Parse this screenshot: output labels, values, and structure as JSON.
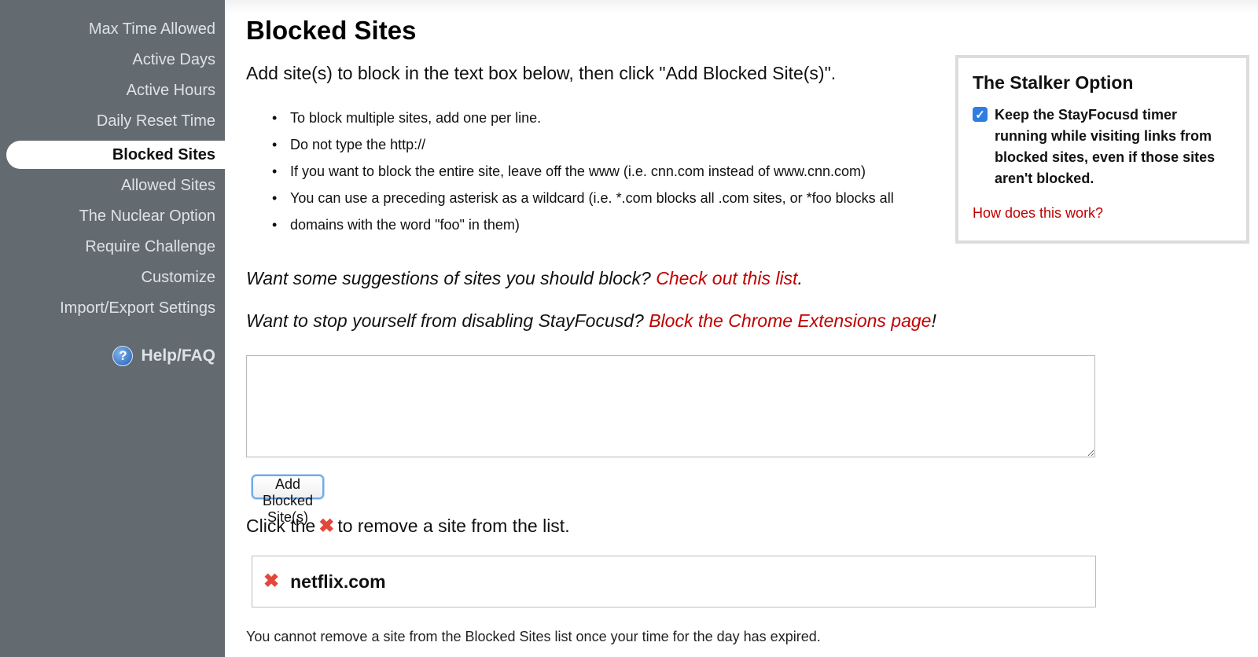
{
  "sidebar": {
    "items": [
      {
        "label": "Max Time Allowed"
      },
      {
        "label": "Active Days"
      },
      {
        "label": "Active Hours"
      },
      {
        "label": "Daily Reset Time"
      },
      {
        "label": "Blocked Sites"
      },
      {
        "label": "Allowed Sites"
      },
      {
        "label": "The Nuclear Option"
      },
      {
        "label": "Require Challenge"
      },
      {
        "label": "Customize"
      },
      {
        "label": "Import/Export Settings"
      }
    ],
    "active_item": "Blocked Sites",
    "help_label": "Help/FAQ",
    "help_icon": "question-circle-icon"
  },
  "main": {
    "title": "Blocked Sites",
    "intro": "Add site(s) to block in the text box below, then click \"Add Blocked Site(s)\".",
    "tips": [
      "To block multiple sites, add one per line.",
      "Do not type the http://",
      "If you want to block the entire site, leave off the www (i.e. cnn.com instead of www.cnn.com)",
      "You can use a preceding asterisk as a wildcard (i.e. *.com blocks all .com sites, or *foo blocks all",
      "domains with the word \"foo\" in them)"
    ],
    "suggest_prefix": "Want some suggestions of sites you should block?",
    "suggest_link": "Check out this list",
    "suggest_suffix": ".",
    "stop_prefix": "Want to stop yourself from disabling StayFocusd?",
    "stop_link": "Block the Chrome Extensions page",
    "stop_suffix": "!",
    "textarea_value": "",
    "add_button": "Add Blocked Site(s)",
    "remove_prefix": "Click the",
    "remove_suffix": "to remove a site from the list.",
    "blocked_sites": [
      "netflix.com"
    ],
    "footnote": "You cannot remove a site from the Blocked Sites list once your time for the day has expired."
  },
  "stalker": {
    "title": "The Stalker Option",
    "checked": true,
    "text": "Keep the StayFocusd timer running while visiting links from blocked sites, even if those sites aren't blocked.",
    "link": "How does this work?"
  },
  "colors": {
    "sidebar_bg": "#636b71",
    "link_red": "#c00000",
    "checkbox_blue": "#2f7de1",
    "remove_icon": "#e2473c"
  }
}
